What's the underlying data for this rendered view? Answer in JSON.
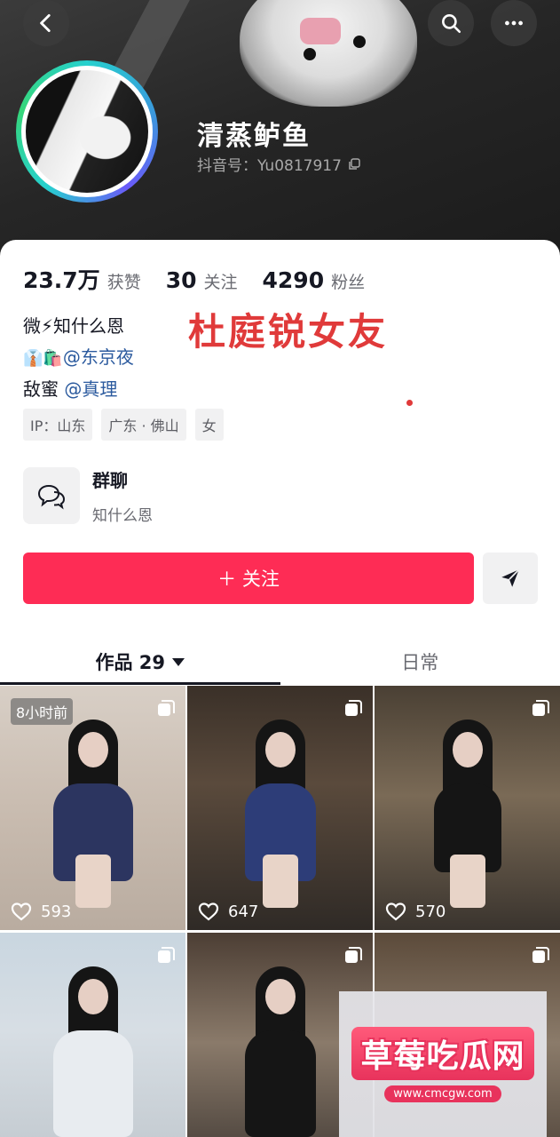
{
  "profile": {
    "nickname": "清蒸鲈鱼",
    "douyin_id": "抖音号：Yu0817917"
  },
  "stats": [
    {
      "value": "23.7万",
      "label": "获赞"
    },
    {
      "value": "30",
      "label": "关注"
    },
    {
      "value": "4290",
      "label": "粉丝"
    }
  ],
  "bio": {
    "line1": "微⚡知什么恩",
    "line2_emoji": "👔🛍️",
    "line2_mention": "@东京夜",
    "line3_prefix": "敌蜜 ",
    "line3_mention": "@真理"
  },
  "overlay_caption": "杜庭锐女友",
  "tags": [
    "IP：山东",
    "广东 · 佛山",
    "女"
  ],
  "group_chat": {
    "title": "群聊",
    "subtitle": "知什么恩"
  },
  "actions": {
    "follow_label": "＋ 关注"
  },
  "tabs": {
    "works_label": "作品 29",
    "daily_label": "日常"
  },
  "grid": {
    "time_badge": "8小时前",
    "likes": [
      "593",
      "647",
      "570"
    ]
  },
  "watermark": {
    "title": "草莓吃瓜网",
    "url": "www.cmcgw.com"
  },
  "colors": {
    "accent": "#fe2c55",
    "mention": "#2b5a9e",
    "overlay_text": "#e03a3a"
  }
}
